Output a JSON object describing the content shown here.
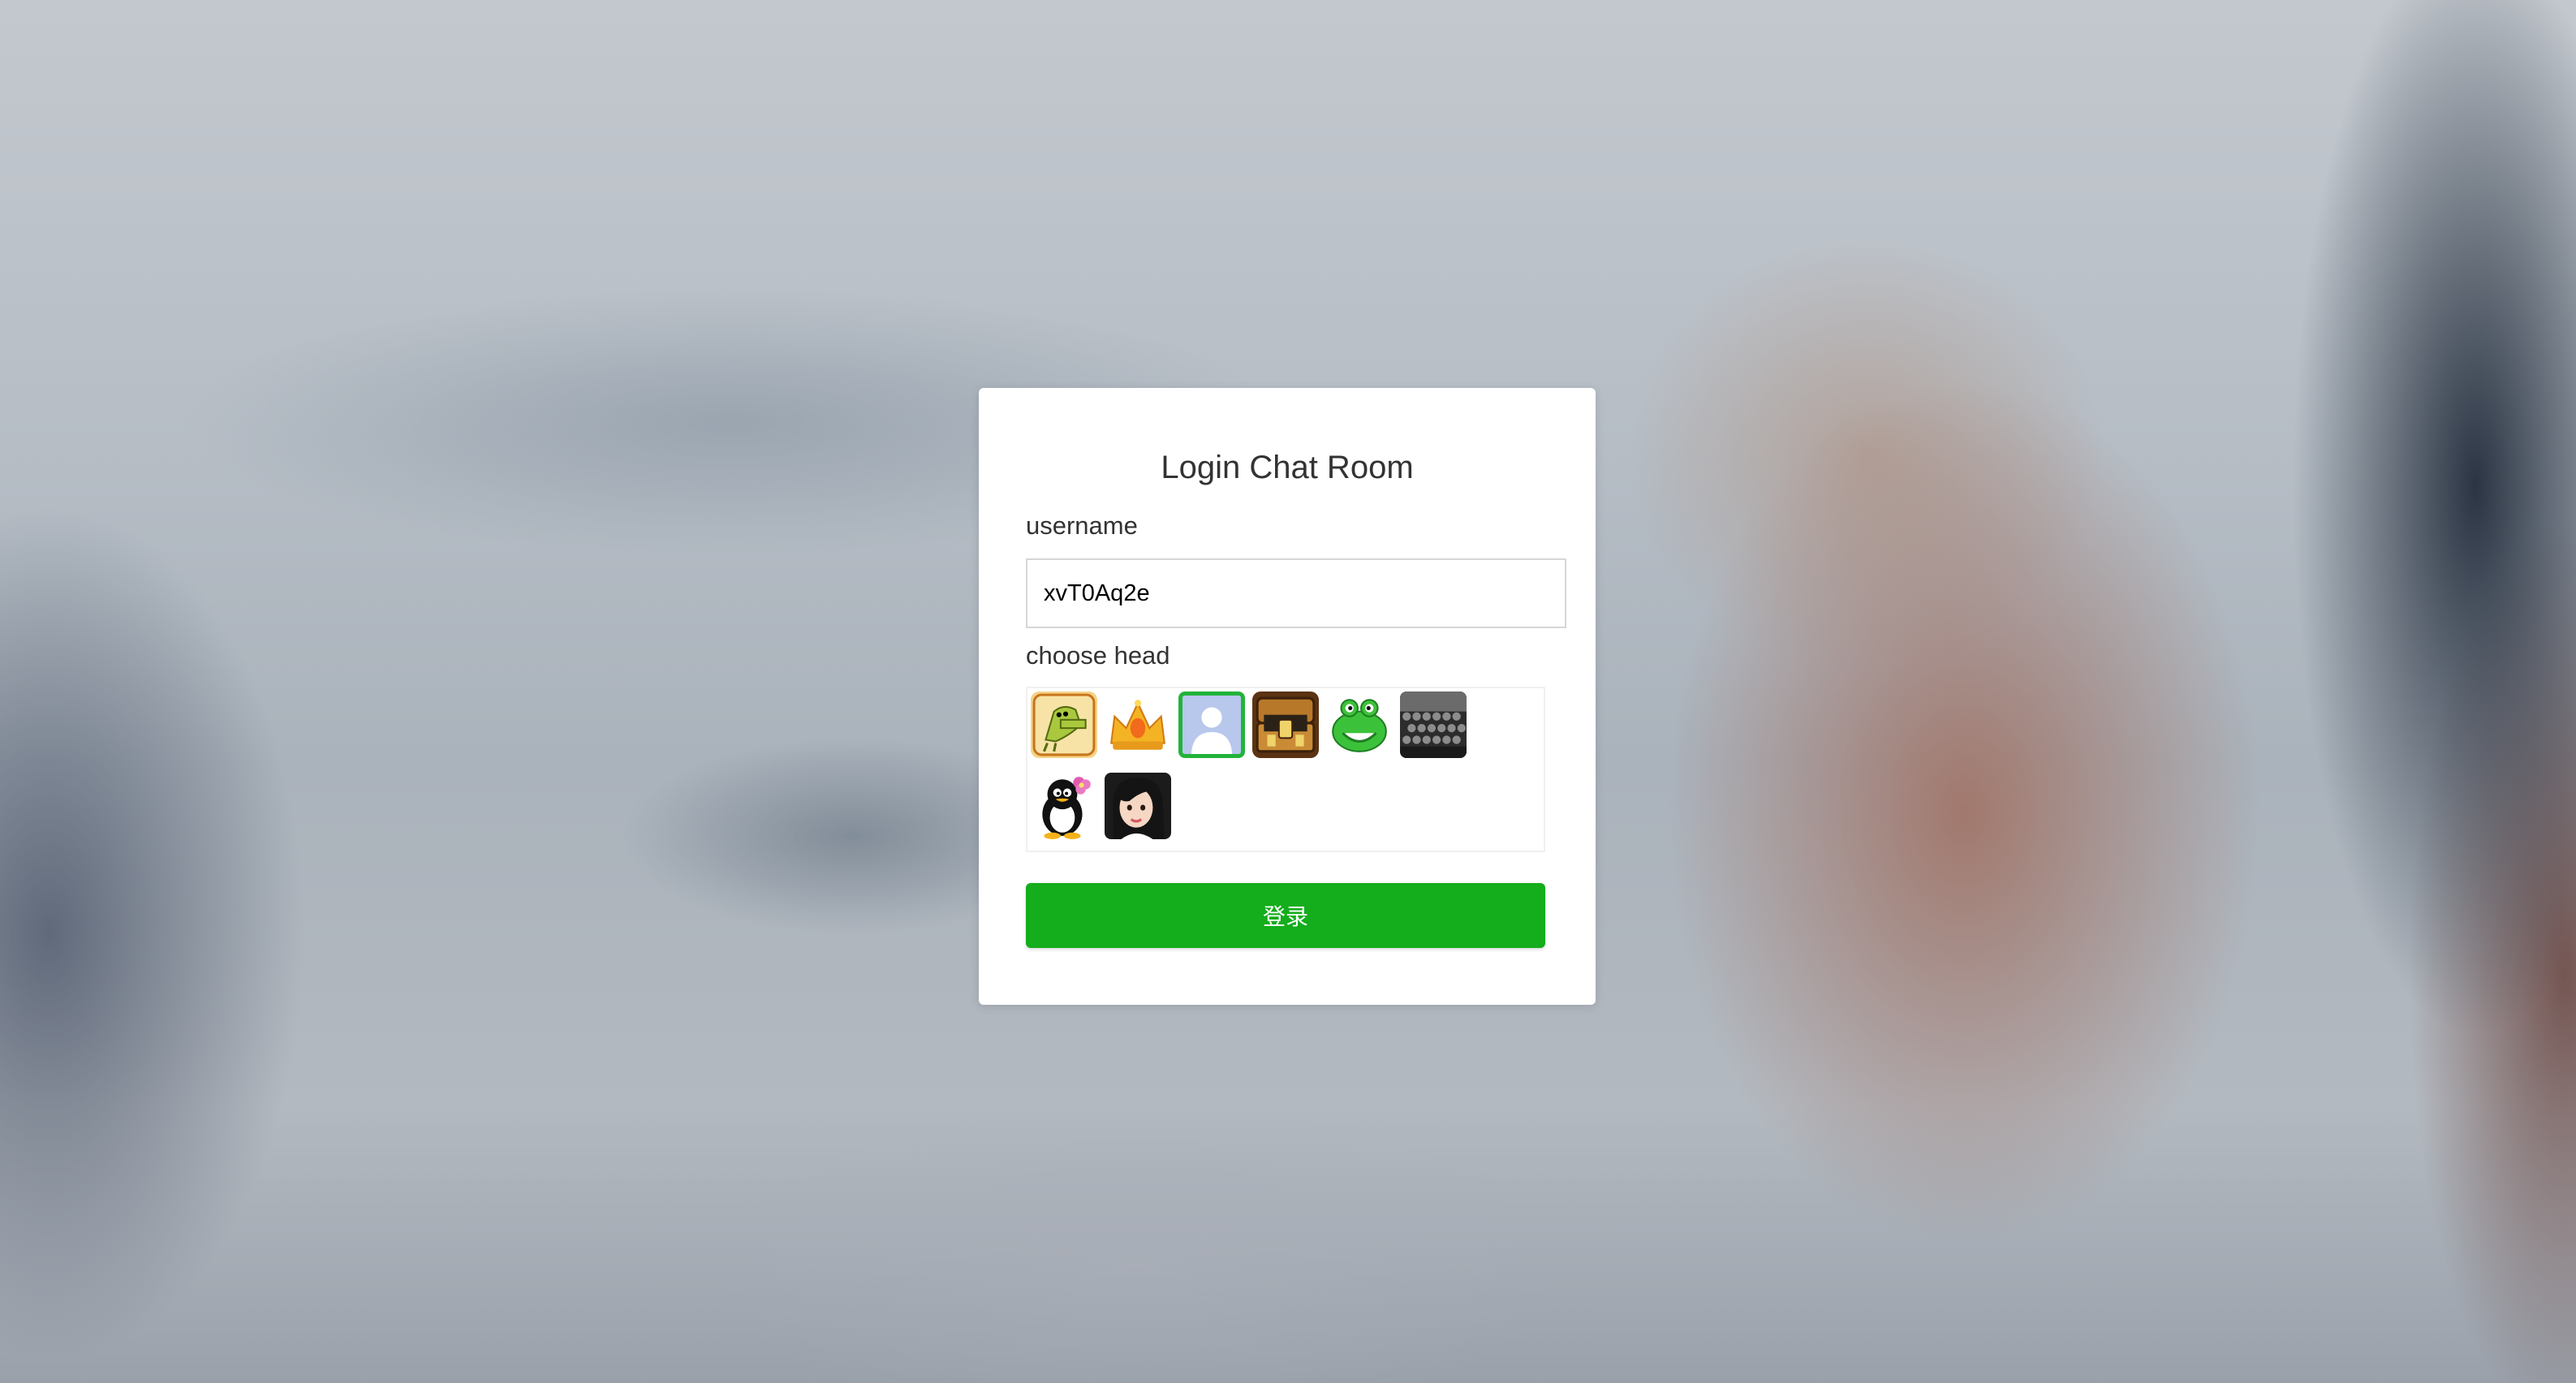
{
  "page": {
    "title": "Login Chat Room"
  },
  "form": {
    "username_label": "username",
    "username_value": "xvT0Aq2e",
    "choose_head_label": "choose head",
    "submit_label": "登录"
  },
  "avatars": [
    {
      "icon": "doodle-jump-avatar-icon",
      "selected": false
    },
    {
      "icon": "gold-crown-avatar-icon",
      "selected": false
    },
    {
      "icon": "default-person-avatar-icon",
      "selected": true
    },
    {
      "icon": "treasure-chest-avatar-icon",
      "selected": false
    },
    {
      "icon": "green-frog-avatar-icon",
      "selected": false
    },
    {
      "icon": "audience-photo-avatar-icon",
      "selected": false
    },
    {
      "icon": "penguin-with-flower-avatar-icon",
      "selected": false
    },
    {
      "icon": "girl-portrait-avatar-icon",
      "selected": false
    }
  ],
  "colors": {
    "accent": "#14ad1c",
    "selected_border": "#22b33a"
  }
}
